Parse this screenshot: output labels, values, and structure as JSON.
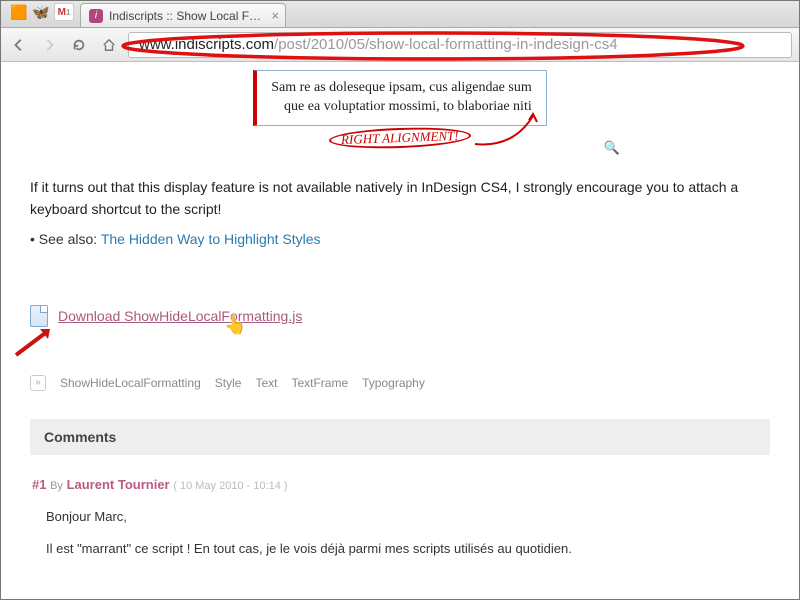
{
  "browser": {
    "tab_title": "Indiscripts :: Show Local F…",
    "url_host": "www.indiscripts.com",
    "url_path": "/post/2010/05/show-local-formatting-in-indesign-cs4"
  },
  "article": {
    "sample_line1": "Sam re as doleseque ipsam, cus aligendae sum",
    "sample_line2": "que ea voluptatior mossimi, to blaboriae niti",
    "annotation": "RIGHT ALIGNMENT!",
    "paragraph": "If it turns out that this display feature is not available natively in InDesign CS4, I strongly encourage you to attach a keyboard shortcut to the script!",
    "see_also_prefix": "• See also:",
    "see_also_link": "The Hidden Way to Highlight Styles",
    "download_label": "Download ShowHideLocalFormatting.js"
  },
  "tags": [
    "ShowHideLocalFormatting",
    "Style",
    "Text",
    "TextFrame",
    "Typography"
  ],
  "comments": {
    "header": "Comments",
    "items": [
      {
        "num": "#1",
        "by": "By",
        "author": "Laurent Tournier",
        "date": "( 10 May 2010 - 10:14 )",
        "body_p1": "Bonjour Marc,",
        "body_p2": "Il est \"marrant\" ce script ! En tout cas, je le vois déjà parmi mes scripts utilisés au quotidien."
      }
    ]
  }
}
